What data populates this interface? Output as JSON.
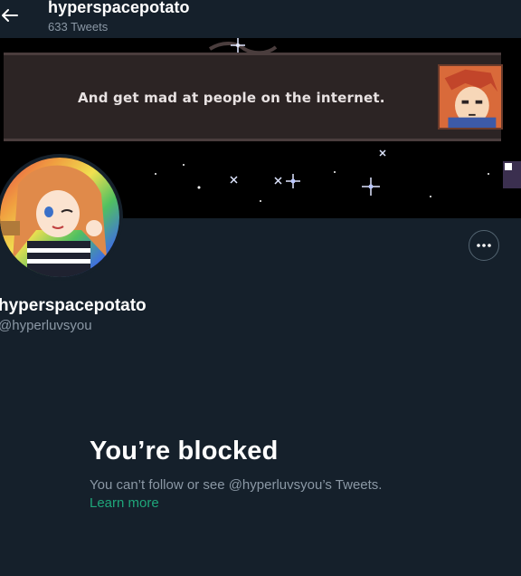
{
  "header": {
    "name": "hyperspacepotato",
    "tweet_count": "633 Tweets"
  },
  "banner": {
    "caption": "And get mad at people on the internet.",
    "background_color": "#000000",
    "dialog_color": "#2c2424"
  },
  "profile": {
    "display_name": "hyperspacepotato",
    "handle": "@hyperluvsyou",
    "more_icon": "ellipsis-icon"
  },
  "blocked": {
    "title": "You’re blocked",
    "description": "You can’t follow or see @hyperluvsyou’s Tweets.",
    "link_text": "Learn more",
    "link_color": "#1fa67a"
  },
  "theme": {
    "background": "#15202b",
    "secondary_text": "#8b98a5",
    "border": "#536471"
  }
}
